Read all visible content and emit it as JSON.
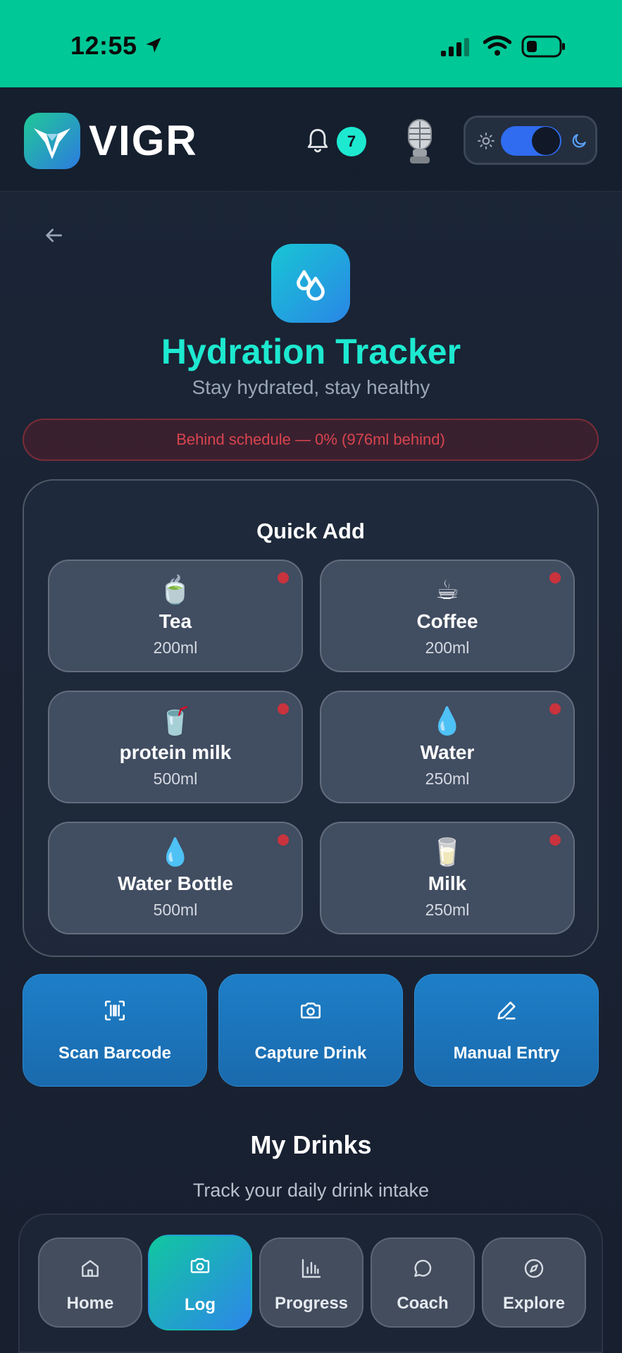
{
  "status_bar": {
    "time": "12:55"
  },
  "header": {
    "app_name": "VIGR",
    "notification_count": "7",
    "theme_mode": "dark"
  },
  "hero": {
    "title": "Hydration Tracker",
    "subtitle": "Stay hydrated, stay healthy"
  },
  "alert": {
    "text": "Behind schedule — 0% (976ml behind)"
  },
  "quick_add": {
    "title": "Quick Add",
    "drinks": [
      {
        "emoji": "🍵",
        "name": "Tea",
        "volume": "200ml"
      },
      {
        "emoji": "☕",
        "name": "Coffee",
        "volume": "200ml"
      },
      {
        "emoji": "🥤",
        "name": "protein milk",
        "volume": "500ml"
      },
      {
        "emoji": "💧",
        "name": "Water",
        "volume": "250ml"
      },
      {
        "emoji": "💧",
        "name": "Water Bottle",
        "volume": "500ml"
      },
      {
        "emoji": "🥛",
        "name": "Milk",
        "volume": "250ml"
      }
    ]
  },
  "actions": {
    "scan": "Scan Barcode",
    "capture": "Capture Drink",
    "manual": "Manual Entry"
  },
  "my_drinks": {
    "title": "My Drinks",
    "subtitle": "Track your daily drink intake"
  },
  "nav": {
    "home": "Home",
    "log": "Log",
    "progress": "Progress",
    "coach": "Coach",
    "explore": "Explore"
  },
  "colors": {
    "status_bar": "#00c896",
    "accent": "#1de9d0",
    "alert": "#d9444f",
    "action": "#1d7fc8"
  }
}
